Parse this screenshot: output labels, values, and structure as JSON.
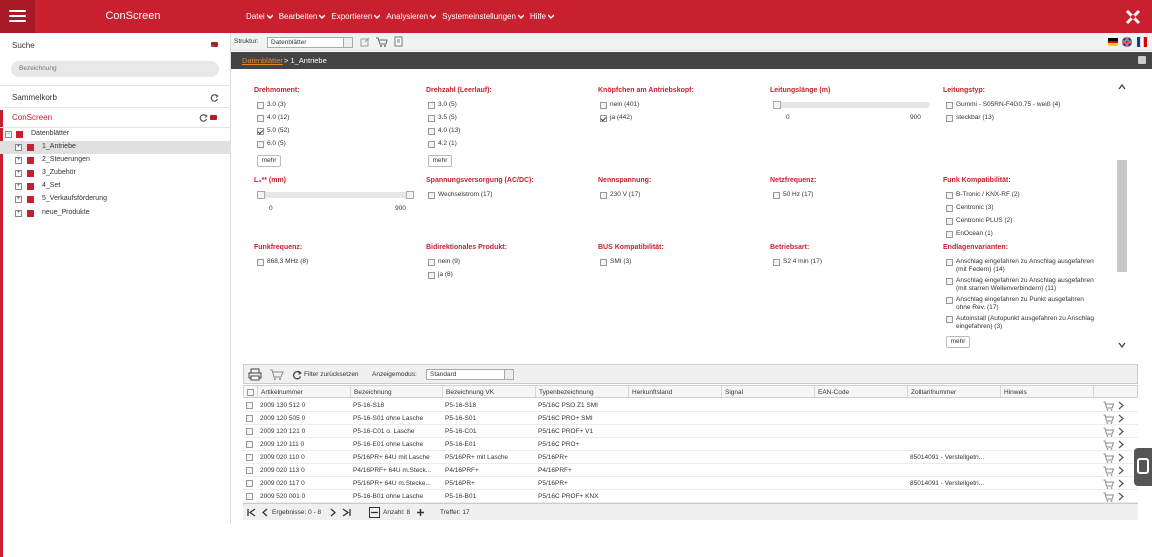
{
  "app": {
    "title": "ConScreen",
    "accent": "#c8202f"
  },
  "menu": [
    {
      "label": "Datei"
    },
    {
      "label": "Bearbeiten"
    },
    {
      "label": "Exportieren"
    },
    {
      "label": "Analysieren"
    },
    {
      "label": "Systemeinstellungen"
    },
    {
      "label": "Hilfe"
    }
  ],
  "sidebar": {
    "search_title": "Suche",
    "search_placeholder": "Bezeichnung",
    "cart_title": "Sammelkorb",
    "tree_title": "ConScreen",
    "tree": [
      {
        "label": "Datenblätter",
        "expander": "−"
      },
      {
        "label": "1_Antriebe",
        "expander": "+"
      },
      {
        "label": "2_Steuerungen",
        "expander": "+"
      },
      {
        "label": "3_Zubehör",
        "expander": "+"
      },
      {
        "label": "4_Set",
        "expander": "+"
      },
      {
        "label": "5_Verkaufsförderung",
        "expander": "+"
      },
      {
        "label": "neue_Produkte",
        "expander": "+"
      }
    ]
  },
  "toolbar": {
    "struktur_label": "Struktur:",
    "struktur_value": "Datenblätter"
  },
  "breadcrumb": {
    "link": "Datenblätter",
    "rest": " > 1_Antriebe"
  },
  "filters": {
    "drehmoment": {
      "title": "Drehmoment:",
      "options": [
        "3.0 (3)",
        "4.0 (12)",
        "5.0 (52)",
        "6.0 (5)"
      ],
      "checked": [
        false,
        false,
        true,
        false
      ],
      "more": "mehr"
    },
    "drehzahl": {
      "title": "Drehzahl (Leerlauf):",
      "options": [
        "3.0 (5)",
        "3.5 (5)",
        "4.0 (13)",
        "4.2 (1)"
      ],
      "more": "mehr"
    },
    "knoepfchen": {
      "title": "Knöpfchen am Antriebskopf:",
      "options": [
        "nein (401)",
        "ja (442)"
      ],
      "checked": [
        false,
        true
      ]
    },
    "leitungslaenge": {
      "title": "Leitungslänge (m)",
      "min": "0",
      "max": "900"
    },
    "leitungstyp": {
      "title": "Leitungstyp:",
      "options": [
        "Gummi - S05RN-F4G0,75 - weiß (4)",
        "steckbar (13)"
      ]
    },
    "l3": {
      "title": "L₃** (mm)",
      "min": "0",
      "max": "900"
    },
    "spannungsversorgung": {
      "title": "Spannungsversorgung (AC/DC):",
      "options": [
        "Wechselstrom (17)"
      ]
    },
    "nennspannung": {
      "title": "Nennspannung:",
      "options": [
        "230 V (17)"
      ]
    },
    "netzfrequenz": {
      "title": "Netzfrequenz:",
      "options": [
        "50 Hz (17)"
      ]
    },
    "funk": {
      "title": "Funk Kompatibilität:",
      "options": [
        "B-Tronic / KNX-RF (2)",
        "Centronic (3)",
        "Centronic PLUS (2)",
        "EnOcean (1)"
      ]
    },
    "funkfrequenz": {
      "title": "Funkfrequenz:",
      "options": [
        "868,3 MHz (8)"
      ]
    },
    "bidirektional": {
      "title": "Bidirektionales Produkt:",
      "options": [
        "nein (9)",
        "ja (8)"
      ]
    },
    "bus": {
      "title": "BUS Kompatibilität:",
      "options": [
        "SMI (3)"
      ]
    },
    "betriebsart": {
      "title": "Betriebsart:",
      "options": [
        "S2 4 min (17)"
      ]
    },
    "endlagen": {
      "title": "Endlagenvarianten:",
      "options": [
        {
          "l1": "Anschlag eingefahren zu Anschlag ausgefahren",
          "l2": "(mit Federn) (14)"
        },
        {
          "l1": "Anschlag eingefahren zu Anschlag ausgefahren",
          "l2": "(mit starren Wellenverbindern) (11)"
        },
        {
          "l1": "Anschlag eingefahren zu Punkt ausgefahren",
          "l2": "ohne Rev. (17)"
        },
        {
          "l1": "Autoinstall (Autopunkt ausgefahren zu Anschlag",
          "l2": "eingefahren) (3)"
        }
      ],
      "more": "mehr"
    }
  },
  "grid": {
    "reset_label": "Filter zurücksetzen",
    "mode_label": "Anzeigemodus:",
    "mode_value": "Standard",
    "columns": [
      "Artikelnummer",
      "Bezeichnung",
      "Bezeichnung VK",
      "Typenbezeichnung",
      "Herkunftsland",
      "Signal",
      "EAN-Code",
      "Zolltarifnummer",
      "Hinweis"
    ],
    "rows": [
      [
        "2009 130 512 0",
        "P5-16-S18",
        "P5-16-S18",
        "P5/16C PSO Z1 SMI",
        "",
        "",
        "",
        "",
        ""
      ],
      [
        "2009 120 505 0",
        "P5-16-S01 ohne Lasche",
        "P5-16-S01",
        "P5/16C PRO+ SMI",
        "",
        "",
        "",
        "",
        ""
      ],
      [
        "2009 120 121 0",
        "P5-16-C01 o. Lasche",
        "P5-16-C01",
        "P5/16C PROF+ V1",
        "",
        "",
        "",
        "",
        ""
      ],
      [
        "2009 120 111 0",
        "P5-16-E01 ohne Lasche",
        "P5-16-E01",
        "P5/16C PRO+",
        "",
        "",
        "",
        "",
        ""
      ],
      [
        "2009 020 110 0",
        "P5/16PR+ 64U mit Lasche",
        "P5/16PR+ mit Lasche",
        "P5/16PR+",
        "",
        "",
        "",
        "85014091 - Verstellgetri...",
        ""
      ],
      [
        "2009 020 113 0",
        "P4/16PRF+ 64U m.Steck...",
        "P4/16PRF+",
        "P4/16PRF+",
        "",
        "",
        "",
        "",
        ""
      ],
      [
        "2009 020 117 0",
        "P5/16PR+ 64U m.Stecke...",
        "P5/16PR+",
        "P5/16PR+",
        "",
        "",
        "",
        "85014091 - Verstellgetri...",
        ""
      ],
      [
        "2009 520 001 0",
        "P5-16-B01 ohne Lasche",
        "P5-16-B01",
        "P5/16C PROF+ KNX",
        "",
        "",
        "",
        "",
        ""
      ]
    ]
  },
  "pager": {
    "results": "Ergebnisse: 0 - 8",
    "count": "Anzahl: 8",
    "hits": "Treffer: 17"
  }
}
